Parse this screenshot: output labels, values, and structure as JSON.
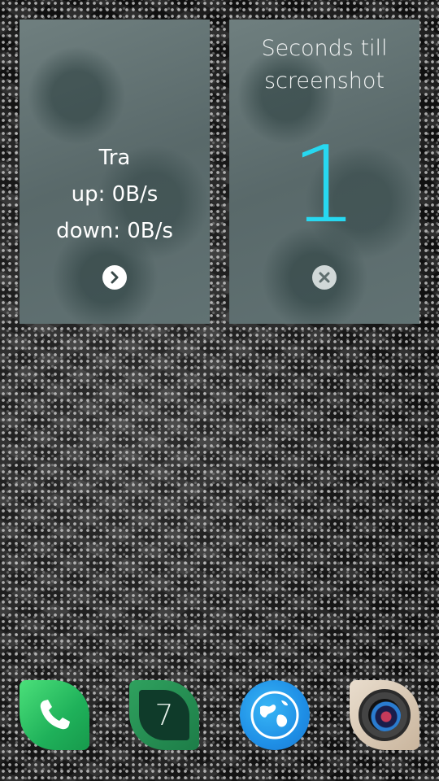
{
  "covers": {
    "traffic": {
      "label": "Tra",
      "up": "up: 0B/s",
      "down": "down: 0B/s",
      "action_icon": "chevron-right-icon"
    },
    "screenshot": {
      "title": "Seconds till screenshot",
      "countdown": "1",
      "countdown_color": "#27d8f0",
      "action_icon": "close-icon"
    }
  },
  "dock": {
    "apps": [
      {
        "name": "phone",
        "icon": "phone-icon"
      },
      {
        "name": "calendar",
        "icon": "calendar-icon",
        "day": "7"
      },
      {
        "name": "browser",
        "icon": "globe-icon"
      },
      {
        "name": "camera",
        "icon": "camera-icon"
      }
    ]
  }
}
